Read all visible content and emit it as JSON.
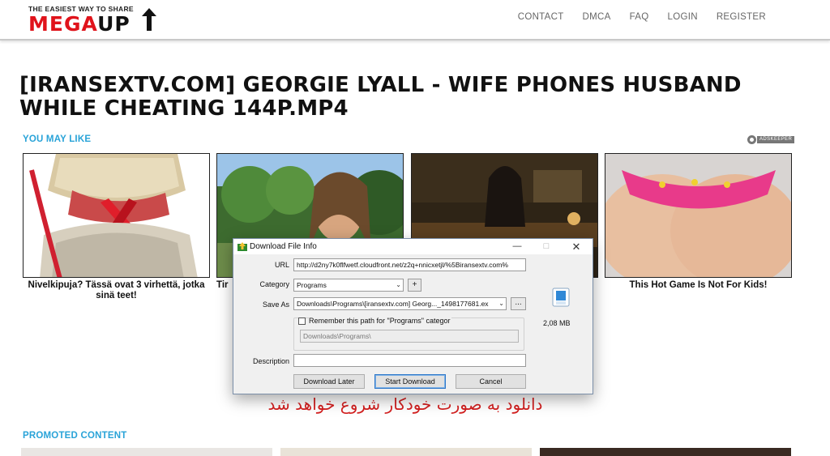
{
  "logo": {
    "tagline": "THE EASIEST WAY TO SHARE",
    "word_main": "MEGA",
    "word_accent": "UP"
  },
  "nav": {
    "items": [
      "CONTACT",
      "DMCA",
      "FAQ",
      "LOGIN",
      "REGISTER"
    ]
  },
  "page": {
    "title": "[IRANSEXTV.COM] GEORGIE LYALL - WIFE PHONES HUSBAND WHILE CHEATING 144P.MP4"
  },
  "sections": {
    "you_may_like": "YOU MAY LIKE",
    "promoted": "PROMOTED CONTENT",
    "ad_badge": "ADSKEEPER"
  },
  "cards": [
    {
      "caption": "Nivelkipuja? Tässä ovat 3 virhettä, jotka sinä teet!"
    },
    {
      "caption": "Tir"
    },
    {
      "caption": ""
    },
    {
      "caption": "This Hot Game Is Not For Kids!"
    }
  ],
  "notice": {
    "persian": "دانلود به صورت خودکار شروع خواهد شد"
  },
  "dialog": {
    "title": "Download File Info",
    "url_label": "URL",
    "url_value": "http://d2ny7k0flfwetf.cloudfront.net/z2q+nnicxetjl/%5Biransextv.com%",
    "category_label": "Category",
    "category_value": "Programs",
    "add_label": "+",
    "saveas_label": "Save As",
    "saveas_value": "Downloads\\Programs\\[iransextv.com] Georg..._1498177681.ex",
    "browse_label": "...",
    "remember_label": "Remember this path for \"Programs\" categor",
    "path_value": "Downloads\\Programs\\",
    "description_label": "Description",
    "description_value": "",
    "file_size": "2,08  MB",
    "btn_later": "Download Later",
    "btn_start": "Start Download",
    "btn_cancel": "Cancel"
  },
  "colors": {
    "brand_red": "#e0131b",
    "accent_blue": "#29a3d8",
    "notice_red": "#d42020"
  }
}
